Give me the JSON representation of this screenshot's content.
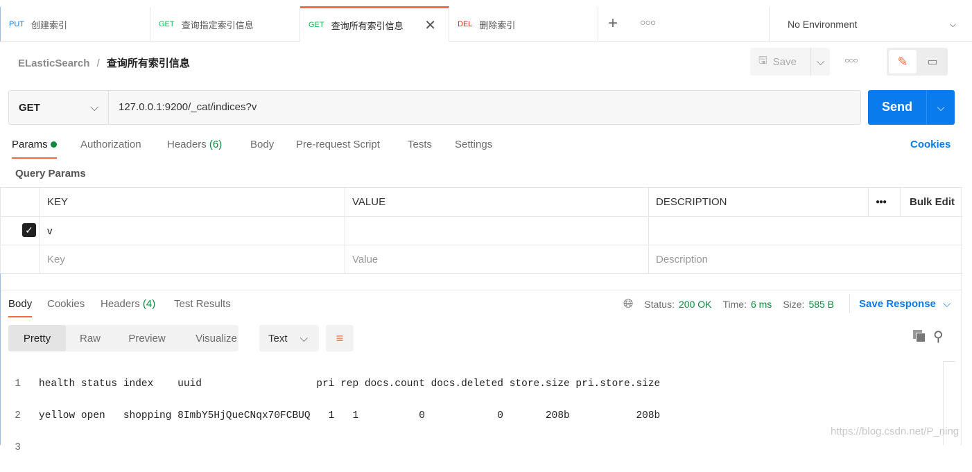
{
  "tabs": [
    {
      "method": "PUT",
      "label": "创建索引"
    },
    {
      "method": "GET",
      "label": "查询指定索引信息"
    },
    {
      "method": "GET",
      "label": "查询所有索引信息"
    },
    {
      "method": "DEL",
      "label": "删除索引"
    }
  ],
  "environment": "No Environment",
  "breadcrumb": {
    "collection": "ELasticSearch",
    "separator": "/",
    "request": "查询所有索引信息"
  },
  "save_label": "Save",
  "request": {
    "method": "GET",
    "url": "127.0.0.1:9200/_cat/indices?v",
    "send_label": "Send"
  },
  "req_tabs": {
    "params": "Params",
    "authorization": "Authorization",
    "headers": "Headers",
    "headers_count": "(6)",
    "body": "Body",
    "prerequest": "Pre-request Script",
    "tests": "Tests",
    "settings": "Settings",
    "cookies": "Cookies"
  },
  "query_params": {
    "title": "Query Params",
    "headers": {
      "key": "KEY",
      "value": "VALUE",
      "description": "DESCRIPTION",
      "bulk_edit": "Bulk Edit"
    },
    "rows": [
      {
        "checked": true,
        "key": "v",
        "value": "",
        "description": ""
      }
    ],
    "placeholders": {
      "key": "Key",
      "value": "Value",
      "description": "Description"
    }
  },
  "response": {
    "tabs": {
      "body": "Body",
      "cookies": "Cookies",
      "headers": "Headers",
      "headers_count": "(4)",
      "test_results": "Test Results"
    },
    "status_label": "Status:",
    "status": "200 OK",
    "time_label": "Time:",
    "time": "6 ms",
    "size_label": "Size:",
    "size": "585 B",
    "save_response": "Save Response",
    "views": {
      "pretty": "Pretty",
      "raw": "Raw",
      "preview": "Preview",
      "visualize": "Visualize"
    },
    "format": "Text",
    "lines": [
      {
        "n": "1",
        "text": "health status index    uuid                   pri rep docs.count docs.deleted store.size pri.store.size"
      },
      {
        "n": "2",
        "text": "yellow open   shopping 8ImbY5HjQueCNqx70FCBUQ   1   1          0            0       208b           208b"
      },
      {
        "n": "3",
        "text": ""
      }
    ]
  },
  "watermark": "https://blog.csdn.net/P_ning",
  "colors": {
    "accent": "#f26b3a",
    "send": "#097bed",
    "success": "#0a8a3a"
  }
}
